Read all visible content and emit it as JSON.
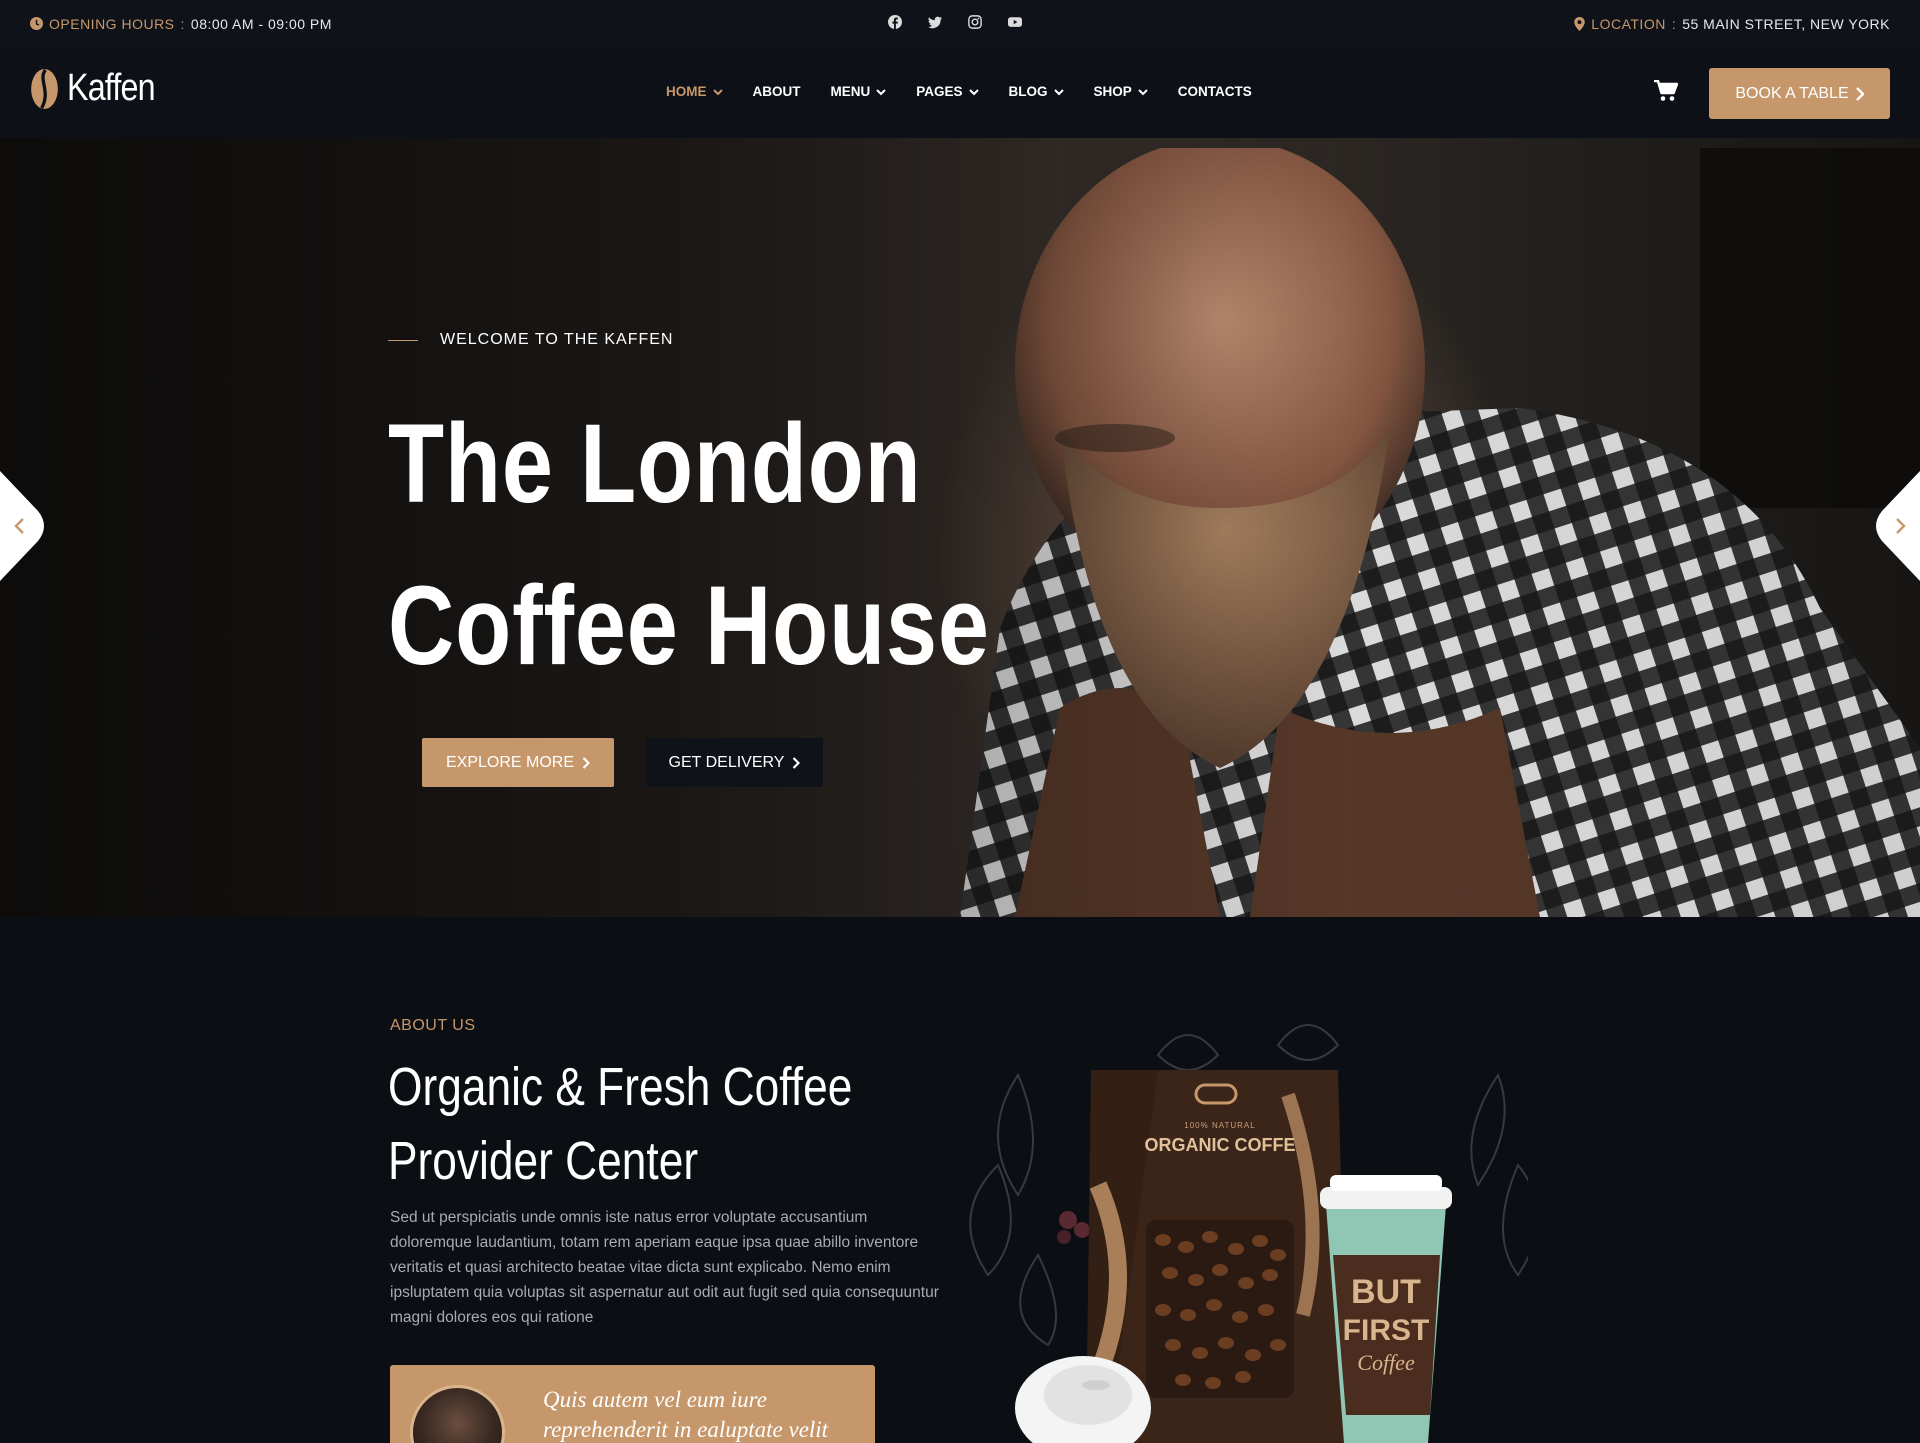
{
  "topbar": {
    "hours_label": "OPENING HOURS",
    "hours_value": "08:00 AM - 09:00 PM",
    "location_label": "LOCATION",
    "location_value": "55 MAIN STREET, NEW YORK",
    "social_icons": [
      "facebook-icon",
      "twitter-icon",
      "instagram-icon",
      "youtube-icon"
    ]
  },
  "header": {
    "brand": "Kaffen",
    "nav": [
      {
        "label": "HOME",
        "dropdown": true,
        "active": true
      },
      {
        "label": "ABOUT",
        "dropdown": false,
        "active": false
      },
      {
        "label": "MENU",
        "dropdown": true,
        "active": false
      },
      {
        "label": "PAGES",
        "dropdown": true,
        "active": false
      },
      {
        "label": "BLOG",
        "dropdown": true,
        "active": false
      },
      {
        "label": "SHOP",
        "dropdown": true,
        "active": false
      },
      {
        "label": "CONTACTS",
        "dropdown": false,
        "active": false
      }
    ],
    "book_button": "BOOK A TABLE"
  },
  "hero": {
    "eyebrow": "WELCOME TO THE KAFFEN",
    "title_line1": "The London",
    "title_line2": "Coffee House",
    "explore_button": "EXPLORE MORE",
    "delivery_button": "GET DELIVERY"
  },
  "about": {
    "label": "ABOUT US",
    "title_line1": "Organic & Fresh Coffee",
    "title_line2": "Provider Center",
    "text": "Sed ut perspiciatis unde omnis iste natus error voluptate accusantium doloremque laudantium, totam rem aperiam eaque ipsa quae abillo inventore veritatis et quasi architecto beatae vitae dicta sunt explicabo. Nemo enim ipsluptatem quia voluptas sit aspernatur aut odit aut fugit sed quia consequuntur magni dolores eos qui ratione",
    "quote_line1": "Quis autem vel eum iure",
    "quote_line2": "reprehenderit in ealuptate velit"
  },
  "product": {
    "bag_small": "100% NATURAL",
    "bag_title": "ORGANIC COFFE",
    "cup_line1": "BUT",
    "cup_line2": "FIRST",
    "cup_line3": "Coffee"
  },
  "colors": {
    "accent": "#c6976a",
    "background": "#0b0e13",
    "topbar": "#0f1319"
  }
}
